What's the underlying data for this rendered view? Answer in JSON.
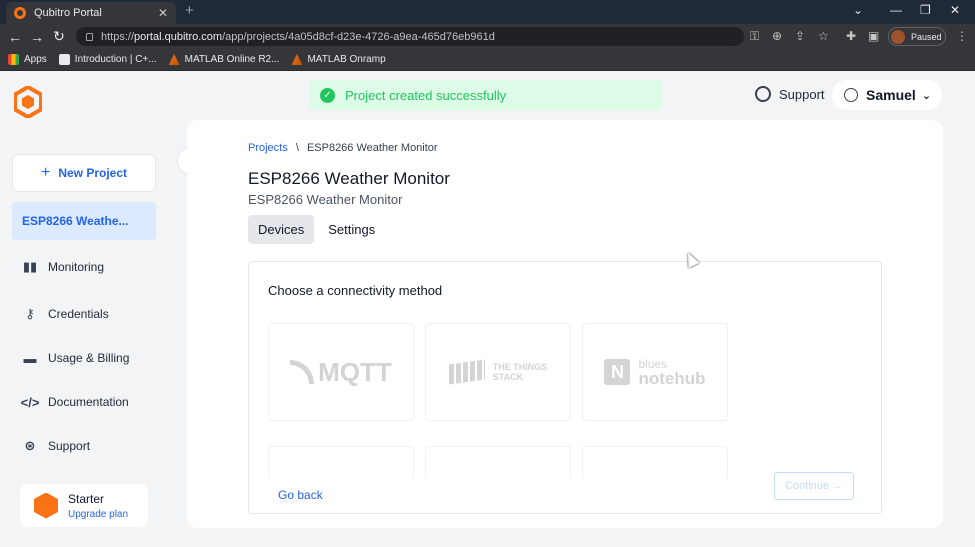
{
  "browser": {
    "tab_title": "Qubitro Portal",
    "new_tab": "+",
    "url_prefix": "https://",
    "url_host": "portal.qubitro.com",
    "url_path": "/app/projects/4a05d8cf-d23e-4726-a9ea-465d76eb961d",
    "profile_status": "Paused",
    "bookmarks": [
      "Apps",
      "Introduction | C+...",
      "MATLAB Online R2...",
      "MATLAB Onramp"
    ]
  },
  "toast": {
    "message": "Project created successfully"
  },
  "header": {
    "support_label": "Support",
    "user_name": "Samuel"
  },
  "sidebar": {
    "new_project": "New Project",
    "active_project": "ESP8266 Weathe...",
    "items": [
      {
        "label": "Monitoring",
        "icon": "bar-chart-icon"
      },
      {
        "label": "Credentials",
        "icon": "key-icon"
      },
      {
        "label": "Usage & Billing",
        "icon": "card-icon"
      },
      {
        "label": "Documentation",
        "icon": "code-icon"
      },
      {
        "label": "Support",
        "icon": "lifebuoy-icon"
      }
    ],
    "plan_name": "Starter",
    "plan_link": "Upgrade plan"
  },
  "main": {
    "breadcrumb_root": "Projects",
    "breadcrumb_sep": "\\",
    "breadcrumb_current": "ESP8266 Weather Monitor",
    "title": "ESP8266 Weather Monitor",
    "subtitle": "ESP8266 Weather Monitor",
    "tabs": [
      {
        "label": "Devices",
        "active": true
      },
      {
        "label": "Settings",
        "active": false
      }
    ],
    "card_title": "Choose a connectivity method",
    "options": {
      "mqtt": "MQTT",
      "tts_line1": "THE THINGS",
      "tts_line2": "STACK",
      "blues_top": "blues",
      "blues_bottom": "notehub"
    },
    "go_back": "Go back",
    "continue": "Continue →"
  },
  "colors": {
    "brand": "#f97316",
    "accent": "#2563eb",
    "success": "#22c55e"
  }
}
